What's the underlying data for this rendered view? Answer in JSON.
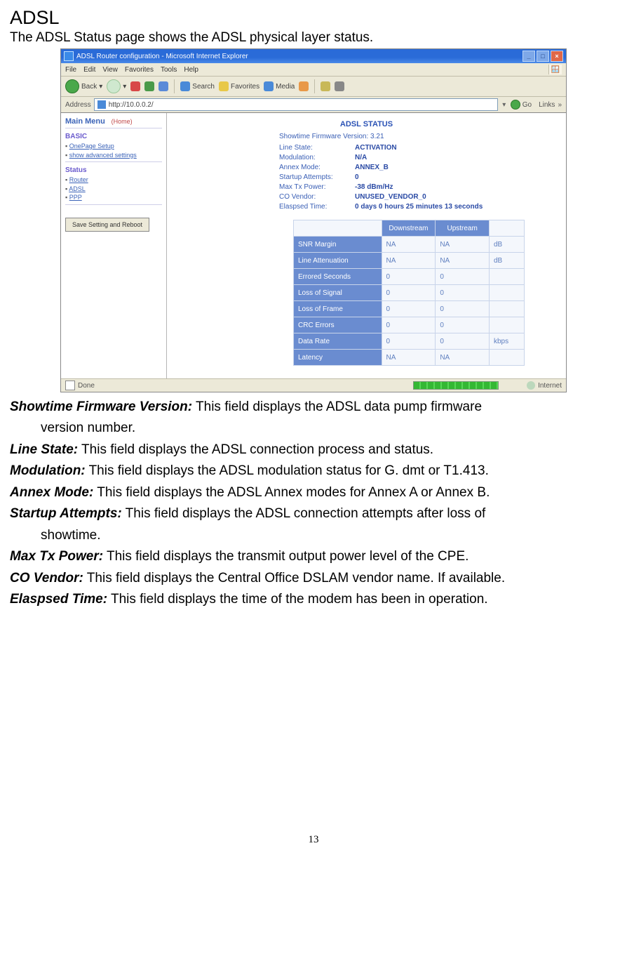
{
  "section_title": "ADSL",
  "intro": "The ADSL Status page shows the ADSL physical layer status.",
  "definitions": [
    {
      "term": "Showtime Firmware Version:",
      "text": " This field displays the ADSL data pump firmware version number.",
      "indent_cont": true
    },
    {
      "term": "Line State:",
      "text": " This field displays the ADSL connection process and status."
    },
    {
      "term": "Modulation:",
      "text": " This field displays the ADSL modulation status for G. dmt or T1.413."
    },
    {
      "term": "Annex Mode:",
      "text": " This field displays the ADSL Annex modes for Annex A or Annex B."
    },
    {
      "term": "Startup Attempts:",
      "text": " This field displays the ADSL connection attempts after loss of showtime.",
      "indent_cont": true
    },
    {
      "term": "Max Tx Power:",
      "text": " This field displays the transmit output power level of the CPE."
    },
    {
      "term": "CO Vendor:",
      "text": " This field displays the Central Office DSLAM vendor name. If available."
    },
    {
      "term": "Elaspsed Time:",
      "text": " This field displays the time of the modem has been in operation."
    }
  ],
  "screenshot": {
    "titlebar": {
      "title": "ADSL Router configuration - Microsoft Internet Explorer",
      "btn_min": "_",
      "btn_max": "□",
      "btn_close": "×"
    },
    "menubar": [
      "File",
      "Edit",
      "View",
      "Favorites",
      "Tools",
      "Help"
    ],
    "toolbar": {
      "back": "Back",
      "search": "Search",
      "favorites": "Favorites",
      "media": "Media"
    },
    "addr": {
      "label": "Address",
      "url": "http://10.0.0.2/",
      "go": "Go",
      "links": "Links"
    },
    "sidebar": {
      "main_menu": "Main Menu",
      "home": "(Home)",
      "basic_hdr": "BASIC",
      "basic_items": [
        "OnePage Setup",
        "show advanced settings"
      ],
      "status_hdr": "Status",
      "status_items": [
        "Router",
        "ADSL",
        "PPP"
      ],
      "save_btn": "Save Setting and Reboot"
    },
    "content": {
      "title": "ADSL  STATUS",
      "firmware_line": "Showtime Firmware Version: 3.21",
      "fields": [
        {
          "label": "Line State:",
          "value": "ACTIVATION"
        },
        {
          "label": "Modulation:",
          "value": "N/A"
        },
        {
          "label": "Annex Mode:",
          "value": "ANNEX_B"
        },
        {
          "label": "Startup Attempts:",
          "value": "0"
        },
        {
          "label": "Max Tx Power:",
          "value": "-38 dBm/Hz"
        },
        {
          "label": "CO Vendor:",
          "value": "UNUSED_VENDOR_0"
        },
        {
          "label": "Elaspsed Time:",
          "value": "0 days 0 hours 25 minutes 13 seconds"
        }
      ],
      "table": {
        "col_down": "Downstream",
        "col_up": "Upstream",
        "rows": [
          {
            "metric": "SNR Margin",
            "down": "NA",
            "up": "NA",
            "unit": "dB"
          },
          {
            "metric": "Line Attenuation",
            "down": "NA",
            "up": "NA",
            "unit": "dB"
          },
          {
            "metric": "Errored Seconds",
            "down": "0",
            "up": "0",
            "unit": ""
          },
          {
            "metric": "Loss of Signal",
            "down": "0",
            "up": "0",
            "unit": ""
          },
          {
            "metric": "Loss of Frame",
            "down": "0",
            "up": "0",
            "unit": ""
          },
          {
            "metric": "CRC Errors",
            "down": "0",
            "up": "0",
            "unit": ""
          },
          {
            "metric": "Data Rate",
            "down": "0",
            "up": "0",
            "unit": "kbps"
          },
          {
            "metric": "Latency",
            "down": "NA",
            "up": "NA",
            "unit": ""
          }
        ]
      }
    },
    "statusbar": {
      "done": "Done",
      "internet": "Internet"
    }
  },
  "page_number": "13"
}
